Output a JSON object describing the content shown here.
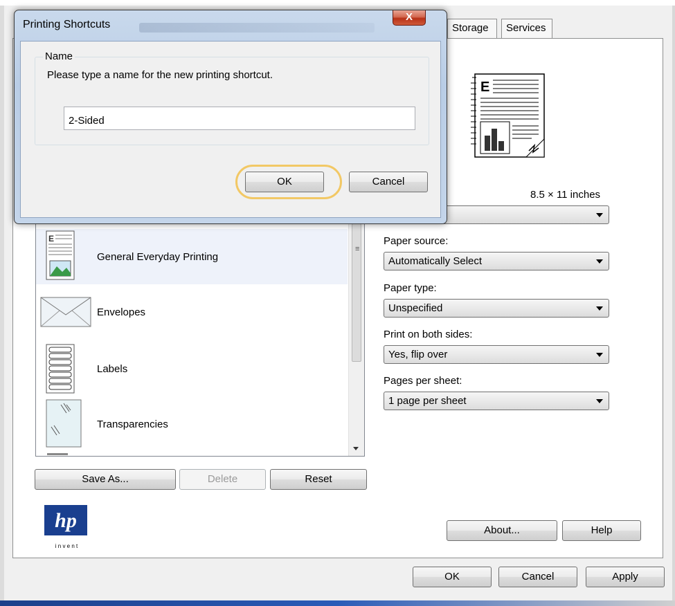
{
  "main_window": {
    "tabs": [
      {
        "label": "Storage"
      },
      {
        "label": "Services"
      }
    ],
    "paper_size_text": "8.5 × 11 inches",
    "paper_source": {
      "label": "Paper source:",
      "value": "Automatically Select"
    },
    "paper_type": {
      "label": "Paper type:",
      "value": "Unspecified"
    },
    "print_both_sides": {
      "label": "Print on both sides:",
      "value": "Yes, flip over"
    },
    "pages_per_sheet": {
      "label": "Pages per sheet:",
      "value": "1 page per sheet"
    },
    "shortcuts": [
      {
        "label": "General Everyday Printing",
        "icon": "document-icon"
      },
      {
        "label": "Envelopes",
        "icon": "envelope-icon"
      },
      {
        "label": "Labels",
        "icon": "labels-icon"
      },
      {
        "label": "Transparencies",
        "icon": "transparency-icon"
      }
    ],
    "buttons": {
      "save_as": "Save As...",
      "delete": "Delete",
      "reset": "Reset",
      "about": "About...",
      "help": "Help",
      "ok": "OK",
      "cancel": "Cancel",
      "apply": "Apply"
    },
    "logo_sub": "i n v e n t"
  },
  "dialog": {
    "title": "Printing Shortcuts",
    "close_label": "X",
    "group_label": "Name",
    "description": "Please type a name for the new printing shortcut.",
    "name_value": "2-Sided",
    "ok_label": "OK",
    "cancel_label": "Cancel"
  },
  "colors": {
    "highlight_ring": "#f2c865",
    "close_button": "#c8412a",
    "dialog_frame": "#b9cde6"
  }
}
